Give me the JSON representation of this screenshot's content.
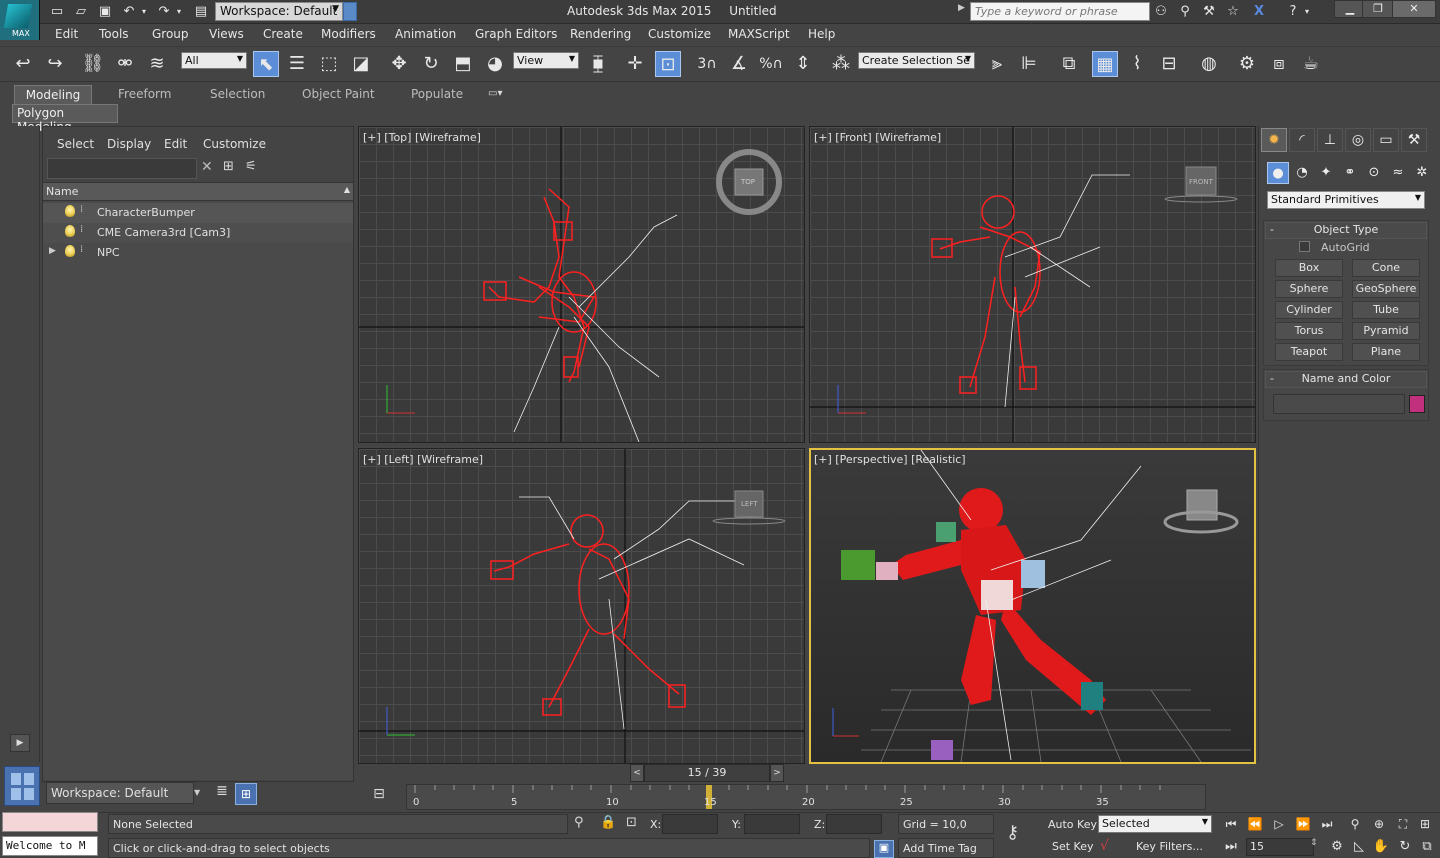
{
  "titlebar": {
    "logo_text": "MAX",
    "workspace": "Workspace: Default",
    "app_name": "Autodesk 3ds Max 2015",
    "doc_name": "Untitled",
    "search_placeholder": "Type a keyword or phrase"
  },
  "menu": [
    "Edit",
    "Tools",
    "Group",
    "Views",
    "Create",
    "Modifiers",
    "Animation",
    "Graph Editors",
    "Rendering",
    "Customize",
    "MAXScript",
    "Help"
  ],
  "toolbar": {
    "selection_filter": "All",
    "reference_coord": "View",
    "named_selection": "Create Selection Se",
    "snap_label": "3",
    "angle_snap_label": "%"
  },
  "ribbon": {
    "tabs": [
      "Modeling",
      "Freeform",
      "Selection",
      "Object Paint",
      "Populate"
    ],
    "panel": "Polygon Modeling"
  },
  "explorer": {
    "tabs": [
      "Select",
      "Display",
      "Edit",
      "Customize"
    ],
    "column_header": "Name",
    "rows": [
      {
        "name": "CharacterBumper",
        "expandable": false
      },
      {
        "name": "CME Camera3rd [Cam3]",
        "expandable": false
      },
      {
        "name": "NPC",
        "expandable": true
      }
    ],
    "workspace": "Workspace: Default"
  },
  "viewports": {
    "top": "[+] [Top] [Wireframe]",
    "front": "[+] [Front] [Wireframe]",
    "left": "[+] [Left] [Wireframe]",
    "perspective": "[+] [Perspective] [Realistic]",
    "cube_top": "TOP",
    "cube_front": "FRONT",
    "cube_left": "LEFT"
  },
  "command_panel": {
    "category": "Standard Primitives",
    "object_type_title": "Object Type",
    "autogrid": "AutoGrid",
    "primitives": [
      "Box",
      "Cone",
      "Sphere",
      "GeoSphere",
      "Cylinder",
      "Tube",
      "Torus",
      "Pyramid",
      "Teapot",
      "Plane"
    ],
    "name_color_title": "Name and Color",
    "color": "#c0307c"
  },
  "timeline": {
    "slider_label": "15 / 39",
    "current_frame": 15,
    "total_frames": 39,
    "ticks": [
      "0",
      "5",
      "10",
      "15",
      "20",
      "25",
      "30",
      "35"
    ]
  },
  "status": {
    "maxscript": "Welcome to M",
    "selection": "None Selected",
    "prompt": "Click or click-and-drag to select objects",
    "x_label": "X:",
    "y_label": "Y:",
    "z_label": "Z:",
    "grid": "Grid = 10,0",
    "add_time_tag": "Add Time Tag",
    "auto_key": "Auto Key",
    "set_key": "Set Key",
    "key_mode": "Selected",
    "key_filters": "Key Filters...",
    "frame": "15"
  }
}
